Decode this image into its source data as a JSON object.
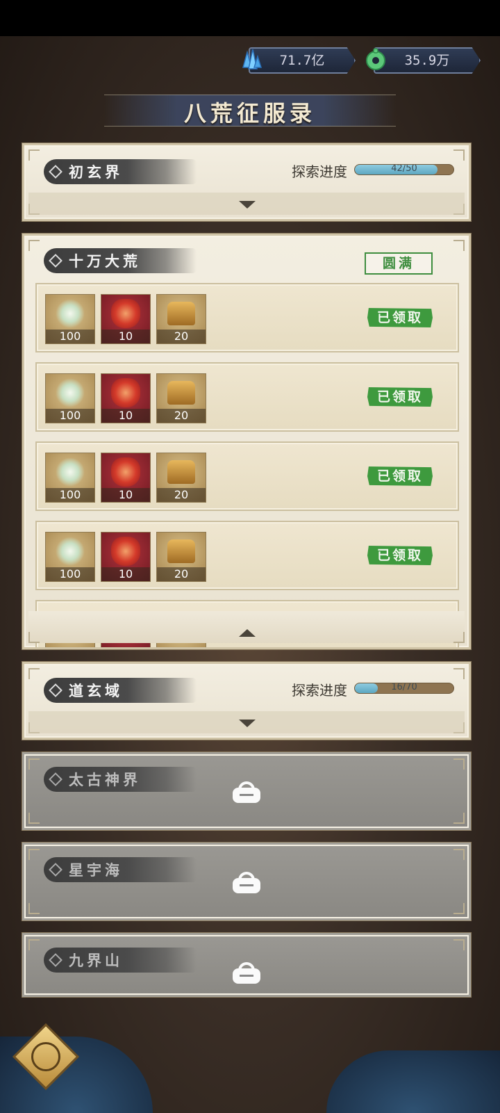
{
  "currency": {
    "gem": {
      "icon": "blue-crystal-icon",
      "value": "71.7亿"
    },
    "jade": {
      "icon": "jade-coin-icon",
      "value": "35.9万"
    }
  },
  "page_title": "八荒征服录",
  "progress_label": "探索进度",
  "realms": [
    {
      "name": "初玄界",
      "progress_text": "42/50",
      "progress": 0.84,
      "state": "collapsed"
    },
    {
      "name": "十万大荒",
      "badge": "圆满",
      "state": "expanded"
    },
    {
      "name": "道玄域",
      "progress_text": "16/70",
      "progress": 0.23,
      "state": "collapsed"
    },
    {
      "name": "太古神界",
      "state": "locked"
    },
    {
      "name": "星宇海",
      "state": "locked"
    },
    {
      "name": "九界山",
      "state": "locked"
    }
  ],
  "rewards": [
    {
      "items": [
        "100",
        "10",
        "20"
      ],
      "status": "已领取"
    },
    {
      "items": [
        "100",
        "10",
        "20"
      ],
      "status": "已领取"
    },
    {
      "items": [
        "100",
        "10",
        "20"
      ],
      "status": "已领取"
    },
    {
      "items": [
        "100",
        "10",
        "20"
      ],
      "status": "已领取"
    }
  ],
  "colors": {
    "claimed_green": "#3e9a3e",
    "progress_blue": "#5da7c1",
    "parchment": "#f3eee1"
  }
}
